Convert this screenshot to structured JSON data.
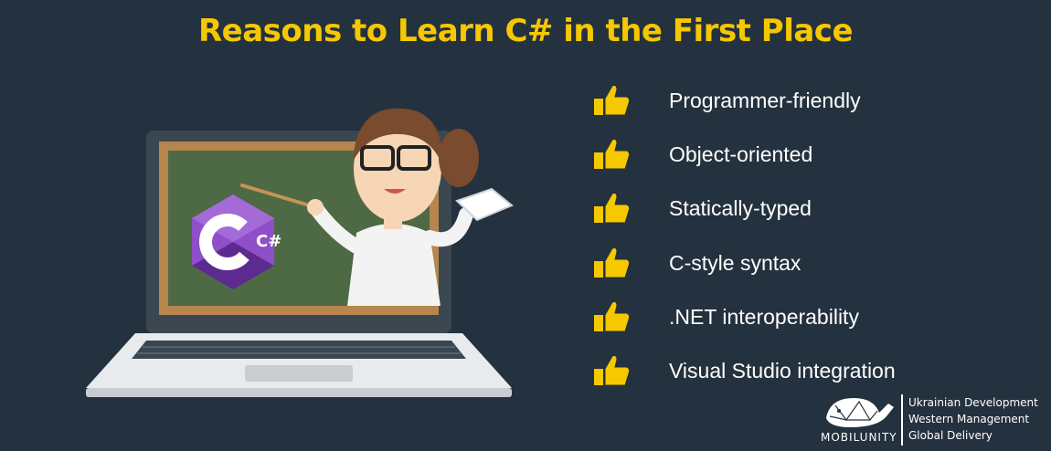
{
  "title": "Reasons to Learn C# in the First Place",
  "logo_text": "C#",
  "reasons": [
    "Programmer-friendly",
    "Object-oriented",
    "Statically-typed",
    "C-style syntax",
    ".NET interoperability",
    "Visual Studio integration"
  ],
  "footer": {
    "brand": "MOBILUNITY",
    "lines": [
      "Ukrainian Development",
      "Western Management",
      "Global Delivery"
    ]
  },
  "colors": {
    "background": "#24313e",
    "accent": "#f5c800",
    "text": "#ffffff"
  },
  "icons": {
    "reason": "thumbs-up-icon",
    "brand": "whale-icon"
  }
}
